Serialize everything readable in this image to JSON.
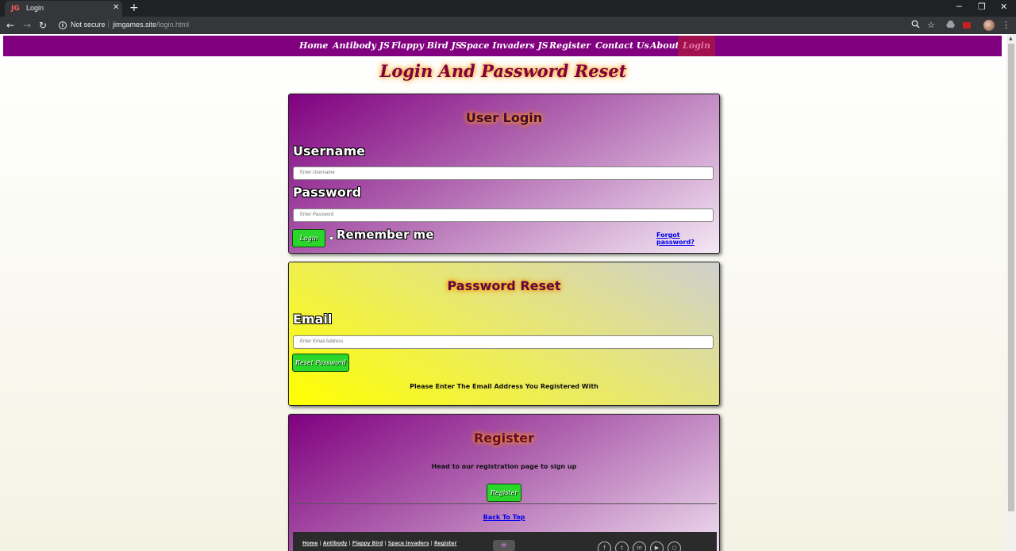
{
  "browser": {
    "tab_title": "Login",
    "tab_favicon": "JG",
    "tab_close": "✕",
    "new_tab": "+",
    "win_minimize": "─",
    "win_restore": "❐",
    "win_close": "✕",
    "back": "←",
    "forward": "→",
    "reload": "↻",
    "security_label": "Not secure",
    "url_host": "jimgames.site",
    "url_path": "/login.html",
    "icons": [
      "zoom-icon",
      "star-icon",
      "extension-drive-icon",
      "extension-red-icon",
      "profile-avatar",
      "menu-icon"
    ]
  },
  "nav": {
    "items": [
      {
        "label": "Home"
      },
      {
        "label": "Antibody JS"
      },
      {
        "label": "Flappy Bird JS"
      },
      {
        "label": "Space Invaders JS"
      },
      {
        "label": "Register"
      },
      {
        "label": "Contact Us"
      },
      {
        "label": "About"
      },
      {
        "label": "Login",
        "active": true
      }
    ]
  },
  "page": {
    "title": "Login And Password Reset"
  },
  "login": {
    "heading": "User Login",
    "username_label": "Username",
    "username_placeholder": "Enter Username",
    "password_label": "Password",
    "password_placeholder": "Enter Password",
    "login_button": "Login",
    "remember_label": "Remember me",
    "forgot_link": "Forgot password?"
  },
  "reset": {
    "heading": "Password Reset",
    "email_label": "Email",
    "email_placeholder": "Enter Email Address",
    "reset_button": "Reset Password",
    "instructions": "Please Enter The Email Address You Registered With"
  },
  "register": {
    "heading": "Register",
    "blurb": "Head to our registration page to sign up",
    "button": "Register",
    "back_to_top": "Back To Top"
  },
  "footer": {
    "links": [
      "Home",
      "Antibody",
      "Flappy Bird",
      "Space Invaders",
      "Register"
    ],
    "separator": "|",
    "logo_glyph": "👾",
    "social": [
      {
        "name": "facebook",
        "glyph": "f"
      },
      {
        "name": "twitter",
        "glyph": "t"
      },
      {
        "name": "linkedin",
        "glyph": "in"
      },
      {
        "name": "youtube",
        "glyph": "▶"
      },
      {
        "name": "github",
        "glyph": "○"
      }
    ]
  },
  "colors": {
    "nav_bg": "#800080",
    "nav_active_bg": "#a0114d",
    "button_green": "#2bd62b",
    "title_color": "#800040",
    "glow": "#f5a623"
  }
}
